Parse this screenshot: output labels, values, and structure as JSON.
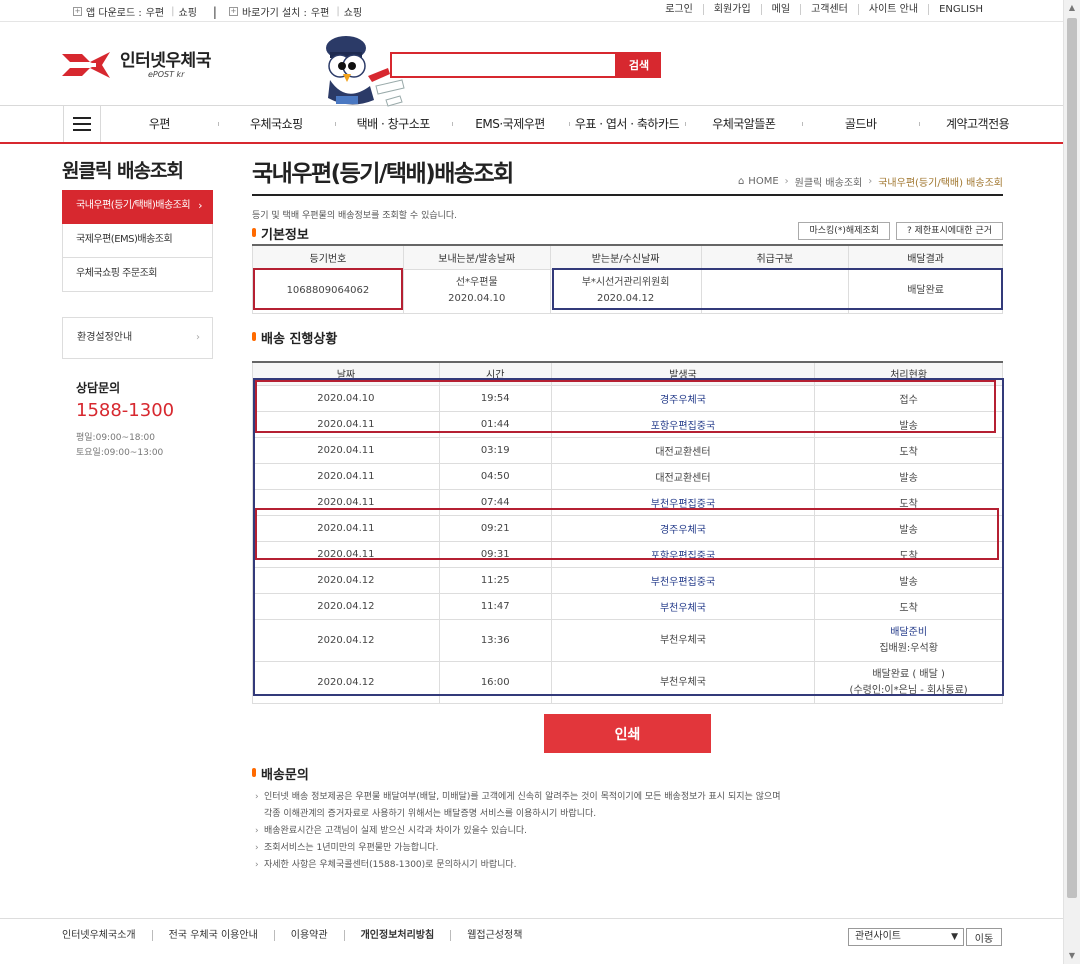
{
  "topbar": {
    "app_download_label": "앱 다운로드 :",
    "app_links": [
      "우편",
      "쇼핑"
    ],
    "shortcut_label": "바로가기 설치 :",
    "shortcut_links": [
      "우편",
      "쇼핑"
    ],
    "right_links": [
      "로그인",
      "회원가입",
      "메일",
      "고객센터",
      "사이트 안내",
      "ENGLISH"
    ]
  },
  "header": {
    "logo_ko": "인터넷우체국",
    "logo_en": "ePOST kr",
    "search_placeholder": "",
    "search_button": "검색"
  },
  "gnb": [
    "우편",
    "우체국쇼핑",
    "택배 · 창구소포",
    "EMS·국제우편",
    "우표 · 엽서 · 축하카드",
    "우체국알뜰폰",
    "골드바",
    "계약고객전용"
  ],
  "lnb": {
    "title": "원클릭 배송조회",
    "items": [
      "국내우편(등기/택배)배송조회",
      "국제우편(EMS)배송조회",
      "우체국쇼핑 주문조회"
    ],
    "env": "환경설정안내",
    "consult_label": "상담문의",
    "consult_tel": "1588-1300",
    "hours": [
      "평일:09:00~18:00",
      "토요일:09:00~13:00"
    ]
  },
  "content": {
    "title": "국내우편(등기/택배)배송조회",
    "breadcrumb": [
      "HOME",
      "원클릭 배송조회",
      "국내우편(등기/택배) 배송조회"
    ],
    "desc": "등기 및 택배 우편물의 배송정보를 조회할 수 있습니다.",
    "basic_title": "기본정보",
    "mask_button": "마스킹(*)해제조회",
    "limit_button": "제한표시에대한 근거",
    "basic_headers": [
      "등기번호",
      "보내는분/발송날짜",
      "받는분/수신날짜",
      "취급구분",
      "배달결과"
    ],
    "basic_row": {
      "number": "1068809064062",
      "sender": "선*우편물",
      "send_date": "2020.04.10",
      "receiver": "부*시선거관리위원회",
      "recv_date": "2020.04.12",
      "handling": "",
      "result": "배달완료"
    },
    "progress_title": "배송 진행상황",
    "progress_headers": [
      "날짜",
      "시간",
      "발생국",
      "처리현황"
    ],
    "progress_rows": [
      {
        "date": "2020.04.10",
        "time": "19:54",
        "office": "경주우체국",
        "status": "접수",
        "link": true
      },
      {
        "date": "2020.04.11",
        "time": "01:44",
        "office": "포항우편집중국",
        "status": "발송",
        "link": true
      },
      {
        "date": "2020.04.11",
        "time": "03:19",
        "office": "대전교환센터",
        "status": "도착",
        "link": false
      },
      {
        "date": "2020.04.11",
        "time": "04:50",
        "office": "대전교환센터",
        "status": "발송",
        "link": false
      },
      {
        "date": "2020.04.11",
        "time": "07:44",
        "office": "부천우편집중국",
        "status": "도착",
        "link": true
      },
      {
        "date": "2020.04.11",
        "time": "09:21",
        "office": "경주우체국",
        "status": "발송",
        "link": true
      },
      {
        "date": "2020.04.11",
        "time": "09:31",
        "office": "포항우편집중국",
        "status": "도착",
        "link": true
      },
      {
        "date": "2020.04.12",
        "time": "11:25",
        "office": "부천우편집중국",
        "status": "발송",
        "link": true
      },
      {
        "date": "2020.04.12",
        "time": "11:47",
        "office": "부천우체국",
        "status": "도착",
        "link": true
      },
      {
        "date": "2020.04.12",
        "time": "13:36",
        "office": "부천우체국",
        "status": "배달준비",
        "status2": "집배원:우석황",
        "link": false
      },
      {
        "date": "2020.04.12",
        "time": "16:00",
        "office": "부천우체국",
        "status": "배달완료 ( 배달 )",
        "status2": "(수령인:이*은님 - 회사동료)",
        "link": false
      }
    ],
    "print_button": "인쇄"
  },
  "notice": {
    "title": "배송문의",
    "lines": [
      "인터넷 배송 정보제공은 우편물 배달여부(배달, 미배달)를 고객에게 신속히 알려주는 것이 목적이기에 모든 배송정보가 표시 되지는 않으며",
      "각종 이해관계의 증거자료로 사용하기 위해서는 배달증명 서비스를 이용하시기 바랍니다.",
      "배송완료시간은 고객님이 실제 받으신 시각과 차이가 있을수 있습니다.",
      "조회서비스는 1년미만의 우편물만 가능합니다.",
      "자세한 사항은 우체국콜센터(1588-1300)로 문의하시기 바랍니다."
    ]
  },
  "footer": {
    "links": [
      "인터넷우체국소개",
      "전국 우체국 이용안내",
      "이용약관",
      "개인정보처리방침",
      "웹접근성정책"
    ],
    "family_select": "관련사이트",
    "go_button": "이동"
  },
  "colors": {
    "accent": "#d7282f",
    "link": "#243b8a",
    "highlight_red": "#b52032",
    "highlight_blue": "#333a7a"
  }
}
